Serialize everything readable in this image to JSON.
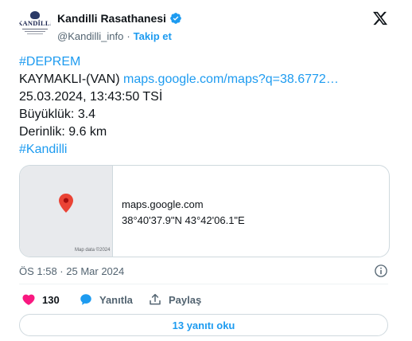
{
  "author": {
    "name": "Kandilli Rasathanesi",
    "handle": "@Kandilli_info",
    "separator": "·",
    "follow_label": "Takip et",
    "avatar_text": "KANDİLLİ"
  },
  "tweet": {
    "hashtag_top": "#DEPREM",
    "location": "KAYMAKLI-(VAN) ",
    "link": "maps.google.com/maps?q=38.6772…",
    "datetime": "25.03.2024, 13:43:50 TSİ",
    "magnitude": "Büyüklük: 3.4",
    "depth": "Derinlik: 9.6 km",
    "hashtag_bottom": "#Kandilli"
  },
  "map_card": {
    "domain": "maps.google.com",
    "coords": "38°40'37.9\"N 43°42'06.1\"E",
    "map_credit": "Map data ©2024"
  },
  "timestamp": "ÖS 1:58 · 25 Mar 2024",
  "actions": {
    "like_count": "130",
    "reply_label": "Yanıtla",
    "share_label": "Paylaş"
  },
  "replies_button": "13 yanıtı oku",
  "colors": {
    "accent": "#1d9bf0",
    "like": "#f91880",
    "text": "#0f1419",
    "muted": "#536471",
    "border": "#cfd9de",
    "pin": "#ea4335"
  }
}
